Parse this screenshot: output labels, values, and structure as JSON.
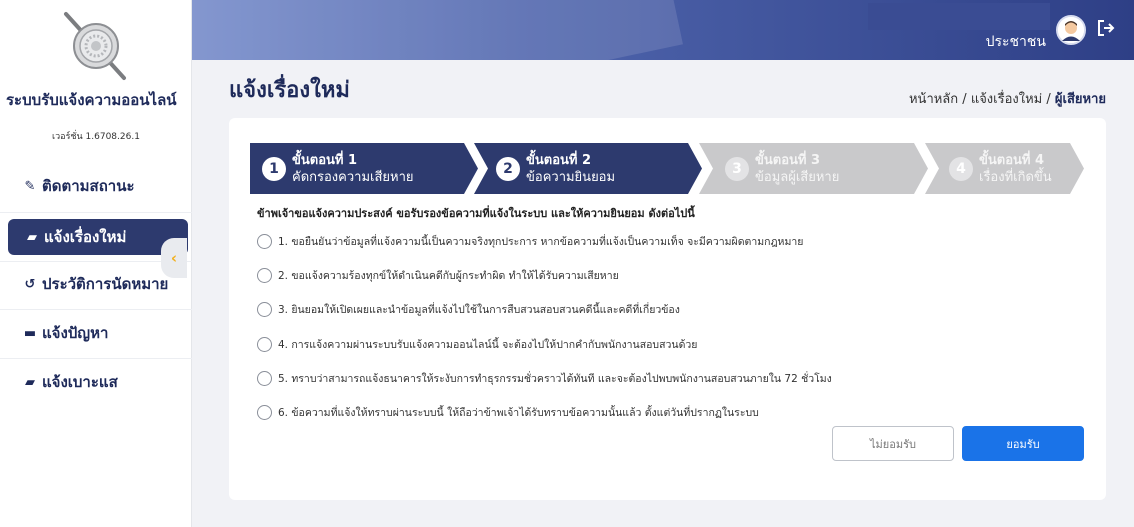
{
  "sidebar": {
    "app_title": "ระบบรับแจ้งความออนไลน์",
    "version": "เวอร์ชั่น 1.6708.26.1",
    "items": [
      {
        "label": "ติดตามสถานะ",
        "icon": "edit-icon"
      },
      {
        "label": "แจ้งเรื่องใหม่",
        "icon": "folder-plus-icon"
      },
      {
        "label": "ประวัติการนัดหมาย",
        "icon": "history-icon"
      },
      {
        "label": "แจ้งปัญหา",
        "icon": "folder-icon"
      },
      {
        "label": "แจ้งเบาะแส",
        "icon": "folder-plus-icon"
      }
    ],
    "active_index": 1
  },
  "header": {
    "user_label": "ประชาชน"
  },
  "page": {
    "title": "แจ้งเรื่องใหม่",
    "breadcrumb": {
      "home": "หน้าหลัก",
      "sep1": " / ",
      "section": "แจ้งเรื่องใหม่",
      "sep2": " / ",
      "current": "ผู้เสียหาย"
    }
  },
  "steps": [
    {
      "num": "1",
      "title": "ขั้นตอนที่ 1",
      "subtitle": "คัดกรองความเสียหาย",
      "state": "done"
    },
    {
      "num": "2",
      "title": "ขั้นตอนที่ 2",
      "subtitle": "ข้อความยินยอม",
      "state": "done"
    },
    {
      "num": "3",
      "title": "ขั้นตอนที่ 3",
      "subtitle": "ข้อมูลผู้เสียหาย",
      "state": "todo"
    },
    {
      "num": "4",
      "title": "ขั้นตอนที่ 4",
      "subtitle": "เรื่องที่เกิดขึ้น",
      "state": "todo"
    }
  ],
  "consent": {
    "intro": "ข้าพเจ้าขอแจ้งความประสงค์ ขอรับรองข้อความที่แจ้งในระบบ และให้ความยินยอม ดังต่อไปนี้",
    "items": [
      "1. ขอยืนยันว่าข้อมูลที่แจ้งความนี้เป็นความจริงทุกประการ หากข้อความที่แจ้งเป็นความเท็จ จะมีความผิดตามกฎหมาย",
      "2. ขอแจ้งความร้องทุกข์ให้ดำเนินคดีกับผู้กระทำผิด ทำให้ได้รับความเสียหาย",
      "3. ยินยอมให้เปิดเผยและนำข้อมูลที่แจ้งไปใช้ในการสืบสวนสอบสวนคดีนี้และคดีที่เกี่ยวข้อง",
      "4. การแจ้งความผ่านระบบรับแจ้งความออนไลน์นี้ จะต้องไปให้ปากคำกับพนักงานสอบสวนด้วย",
      "5. ทราบว่าสามารถแจ้งธนาคารให้ระงับการทำธุรกรรมชั่วคราวได้ทันที และจะต้องไปพบพนักงานสอบสวนภายใน 72 ชั่วโมง",
      "6. ข้อความที่แจ้งให้ทราบผ่านระบบนี้ ให้ถือว่าข้าพเจ้าได้รับทราบข้อความนั้นแล้ว ตั้งแต่วันที่ปรากฏในระบบ"
    ]
  },
  "buttons": {
    "decline": "ไม่ยอมรับ",
    "accept": "ยอมรับ"
  },
  "colors": {
    "primary_navy": "#2d3a6e",
    "accept_blue": "#1a73e8",
    "step_inactive": "#c9c9cb",
    "accent_yellow": "#f2b01e"
  }
}
